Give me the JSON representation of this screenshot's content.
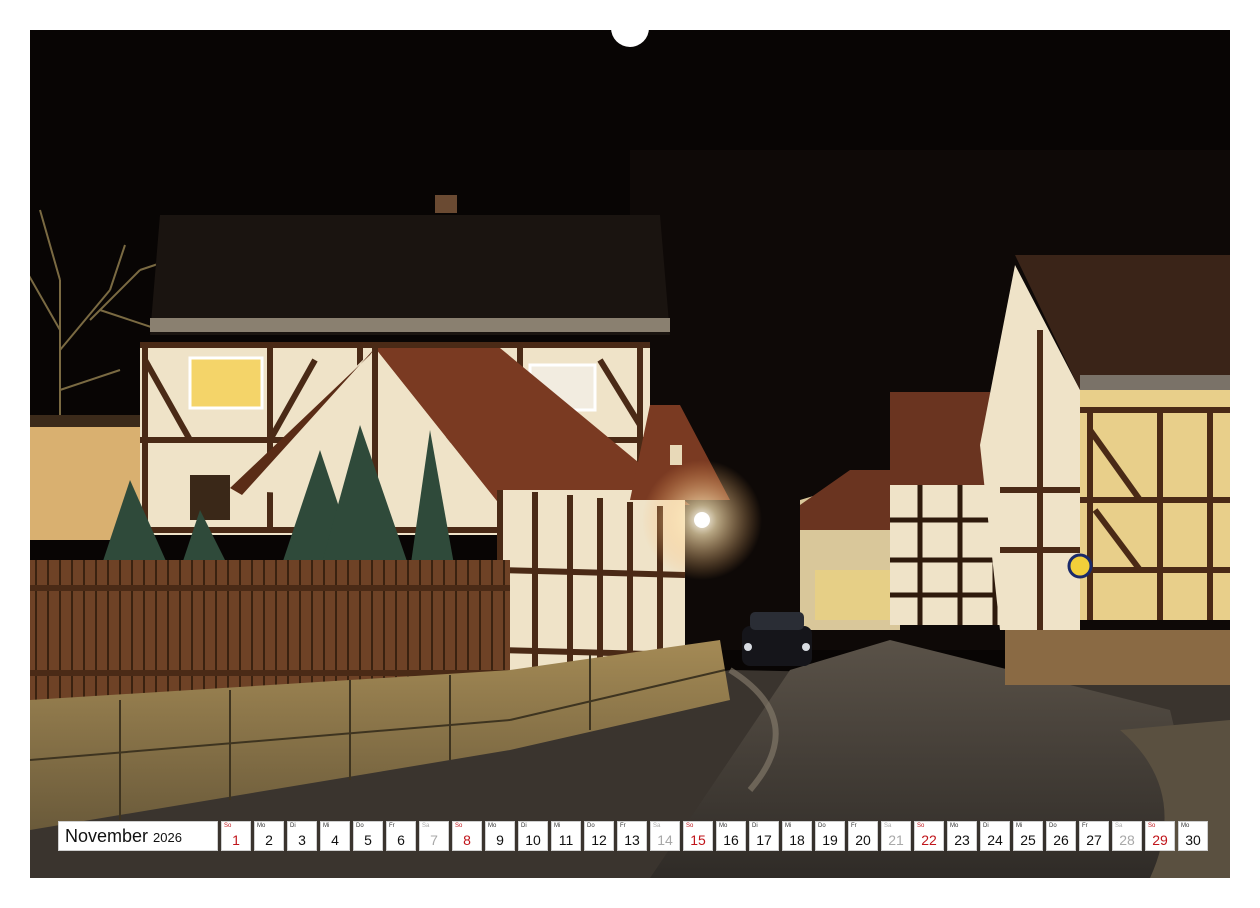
{
  "calendar": {
    "month": "November",
    "year": "2026",
    "days": [
      {
        "wd": "So",
        "d": "1",
        "type": "sun"
      },
      {
        "wd": "Mo",
        "d": "2",
        "type": "week"
      },
      {
        "wd": "Di",
        "d": "3",
        "type": "week"
      },
      {
        "wd": "Mi",
        "d": "4",
        "type": "week"
      },
      {
        "wd": "Do",
        "d": "5",
        "type": "week"
      },
      {
        "wd": "Fr",
        "d": "6",
        "type": "week"
      },
      {
        "wd": "Sa",
        "d": "7",
        "type": "sat"
      },
      {
        "wd": "So",
        "d": "8",
        "type": "sun"
      },
      {
        "wd": "Mo",
        "d": "9",
        "type": "week"
      },
      {
        "wd": "Di",
        "d": "10",
        "type": "week"
      },
      {
        "wd": "Mi",
        "d": "11",
        "type": "week"
      },
      {
        "wd": "Do",
        "d": "12",
        "type": "week"
      },
      {
        "wd": "Fr",
        "d": "13",
        "type": "week"
      },
      {
        "wd": "Sa",
        "d": "14",
        "type": "sat"
      },
      {
        "wd": "So",
        "d": "15",
        "type": "sun"
      },
      {
        "wd": "Mo",
        "d": "16",
        "type": "week"
      },
      {
        "wd": "Di",
        "d": "17",
        "type": "week"
      },
      {
        "wd": "Mi",
        "d": "18",
        "type": "week"
      },
      {
        "wd": "Do",
        "d": "19",
        "type": "week"
      },
      {
        "wd": "Fr",
        "d": "20",
        "type": "week"
      },
      {
        "wd": "Sa",
        "d": "21",
        "type": "sat"
      },
      {
        "wd": "So",
        "d": "22",
        "type": "sun"
      },
      {
        "wd": "Mo",
        "d": "23",
        "type": "week"
      },
      {
        "wd": "Di",
        "d": "24",
        "type": "week"
      },
      {
        "wd": "Mi",
        "d": "25",
        "type": "week"
      },
      {
        "wd": "Do",
        "d": "26",
        "type": "week"
      },
      {
        "wd": "Fr",
        "d": "27",
        "type": "week"
      },
      {
        "wd": "Sa",
        "d": "28",
        "type": "sat"
      },
      {
        "wd": "So",
        "d": "29",
        "type": "sun"
      },
      {
        "wd": "Mo",
        "d": "30",
        "type": "week"
      }
    ]
  },
  "colors": {
    "sunday": "#c0141a",
    "saturday": "#a8a8a8",
    "weekday": "#111111",
    "sky": "#080504",
    "plaster_lit": "#efe3c8",
    "timber": "#4a2a16",
    "roof_tile": "#7a3a22"
  },
  "photo": {
    "subject": "night-village-street-half-timbered-houses"
  }
}
